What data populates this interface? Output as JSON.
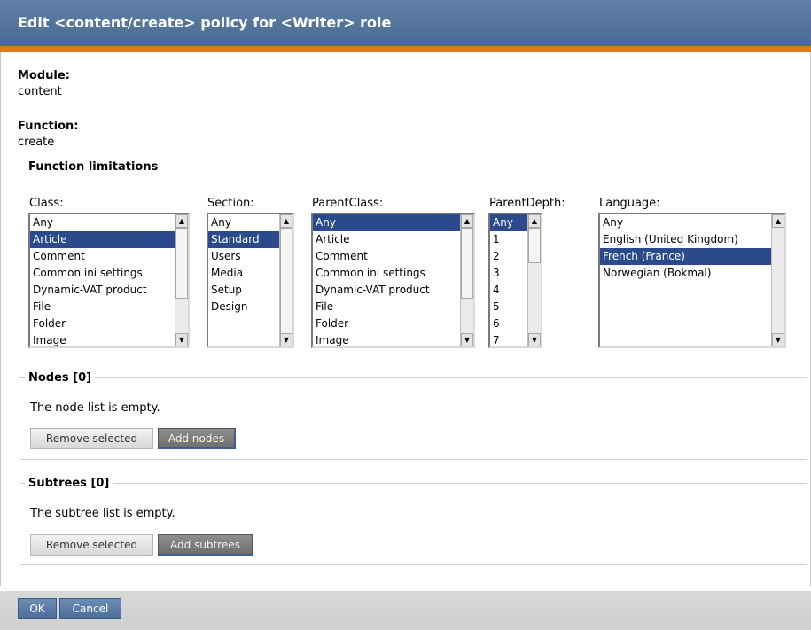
{
  "title": "Edit <content/create> policy for <Writer> role",
  "module": {
    "label": "Module:",
    "value": "content"
  },
  "function": {
    "label": "Function:",
    "value": "create"
  },
  "limitations": {
    "legend": "Function limitations",
    "class": {
      "label": "Class:",
      "options": [
        "Any",
        "Article",
        "Comment",
        "Common ini settings",
        "Dynamic-VAT product",
        "File",
        "Folder",
        "Image"
      ],
      "selected": "Article"
    },
    "section": {
      "label": "Section:",
      "options": [
        "Any",
        "Standard",
        "Users",
        "Media",
        "Setup",
        "Design"
      ],
      "selected": "Standard"
    },
    "parentclass": {
      "label": "ParentClass:",
      "options": [
        "Any",
        "Article",
        "Comment",
        "Common ini settings",
        "Dynamic-VAT product",
        "File",
        "Folder",
        "Image"
      ],
      "selected": "Any"
    },
    "parentdepth": {
      "label": "ParentDepth:",
      "options": [
        "Any",
        "1",
        "2",
        "3",
        "4",
        "5",
        "6",
        "7"
      ],
      "selected": "Any"
    },
    "language": {
      "label": "Language:",
      "options": [
        "Any",
        "English (United Kingdom)",
        "French (France)",
        "Norwegian (Bokmal)"
      ],
      "selected": "French (France)"
    }
  },
  "nodes": {
    "legend": "Nodes [0]",
    "empty_text": "The node list is empty.",
    "remove_label": "Remove selected",
    "add_label": "Add nodes"
  },
  "subtrees": {
    "legend": "Subtrees [0]",
    "empty_text": "The subtree list is empty.",
    "remove_label": "Remove selected",
    "add_label": "Add subtrees"
  },
  "footer": {
    "ok_label": "OK",
    "cancel_label": "Cancel"
  }
}
